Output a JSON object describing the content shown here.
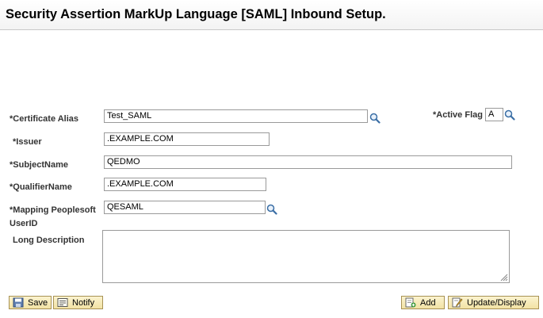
{
  "header": {
    "title": "Security Assertion MarkUp Language [SAML] Inbound Setup."
  },
  "form": {
    "certificate_alias": {
      "label": "*Certificate Alias",
      "value": "Test_SAML"
    },
    "active_flag": {
      "label": "*Active Flag",
      "value": "A"
    },
    "issuer": {
      "label": "*Issuer",
      "value": ".EXAMPLE.COM"
    },
    "subject_name": {
      "label": "*SubjectName",
      "value": "QEDMO"
    },
    "qualifier_name": {
      "label": "*QualifierName",
      "value": ".EXAMPLE.COM"
    },
    "mapping_userid": {
      "label_line1": "*Mapping Peoplesoft",
      "label_line2": "UserID",
      "value": "QESAML"
    },
    "long_description": {
      "label": "Long Description",
      "value": ""
    }
  },
  "buttons": {
    "save": "Save",
    "notify": "Notify",
    "add": "Add",
    "update_display": "Update/Display"
  },
  "icons": {
    "lookup": "magnifier-icon",
    "save": "floppy-disk-icon",
    "notify": "notify-icon",
    "add": "add-page-icon",
    "update_display": "edit-pencil-icon"
  }
}
